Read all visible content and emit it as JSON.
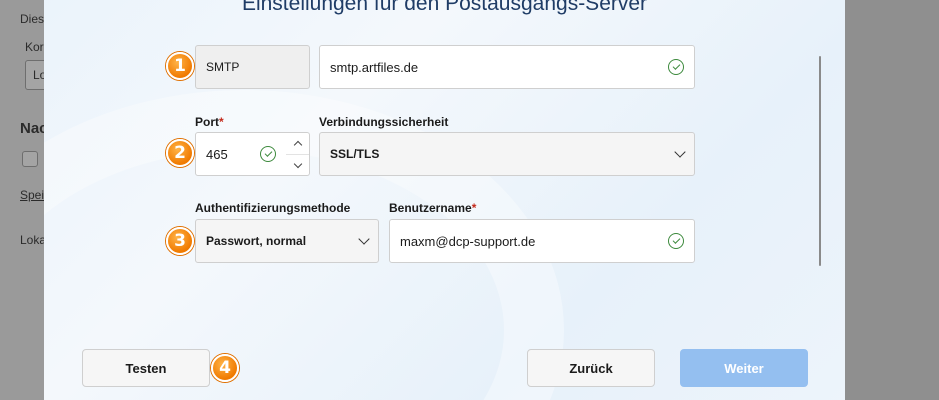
{
  "background": {
    "text_1": "Dies",
    "text_2": "Kor",
    "box_value": "Lo",
    "heading": "Nac",
    "link": "Spei",
    "text_3": "Loka"
  },
  "dialog": {
    "title": "Einstellungen für den Postausgangs-Server",
    "server_type": "SMTP",
    "server_host": "smtp.artfiles.de",
    "port_label": "Port",
    "port_required_mark": "*",
    "port_value": "465",
    "security_label": "Verbindungssicherheit",
    "security_value": "SSL/TLS",
    "auth_label": "Authentifizierungsmethode",
    "auth_value": "Passwort, normal",
    "username_label": "Benutzername",
    "username_required_mark": "*",
    "username_value": "maxm@dcp-support.de"
  },
  "badges": [
    "1",
    "2",
    "3",
    "4"
  ],
  "buttons": {
    "test": "Testen",
    "back": "Zurück",
    "next": "Weiter"
  },
  "colors": {
    "badge": "#f07a00",
    "primary_button": "#94bff0",
    "check": "#3d8a3d",
    "title": "#1f3c66"
  }
}
